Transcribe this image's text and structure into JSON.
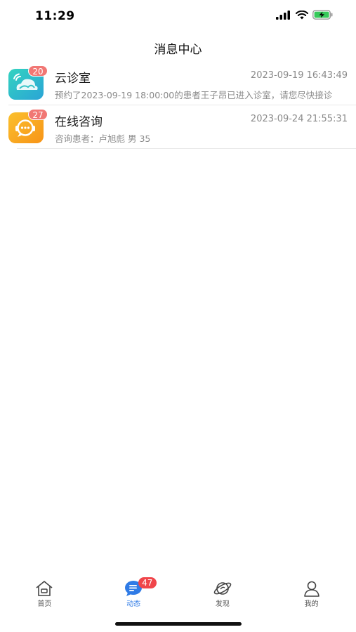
{
  "status_bar": {
    "time": "11:29"
  },
  "header": {
    "title": "消息中心"
  },
  "messages": [
    {
      "icon": "cloud-clinic-icon",
      "badge": "20",
      "title": "云诊室",
      "time": "2023-09-19 16:43:49",
      "preview": "预约了2023-09-19 18:00:00的患者王子昂已进入诊室，请您尽快接诊"
    },
    {
      "icon": "chat-consult-icon",
      "badge": "27",
      "title": "在线咨询",
      "time": "2023-09-24 21:55:31",
      "preview": "咨询患者：卢旭彪 男 35"
    }
  ],
  "tabbar": {
    "items": [
      {
        "label": "首页",
        "icon": "home-icon"
      },
      {
        "label": "动态",
        "icon": "message-icon",
        "badge": "47"
      },
      {
        "label": "发现",
        "icon": "planet-icon"
      },
      {
        "label": "我的",
        "icon": "person-icon"
      }
    ],
    "active_color": "#2f7be6"
  },
  "colors": {
    "badge": "#f17774",
    "tab_badge": "#f0454a",
    "cloud_icon": "#2ec7c0",
    "chat_icon": "#f7a21b"
  }
}
